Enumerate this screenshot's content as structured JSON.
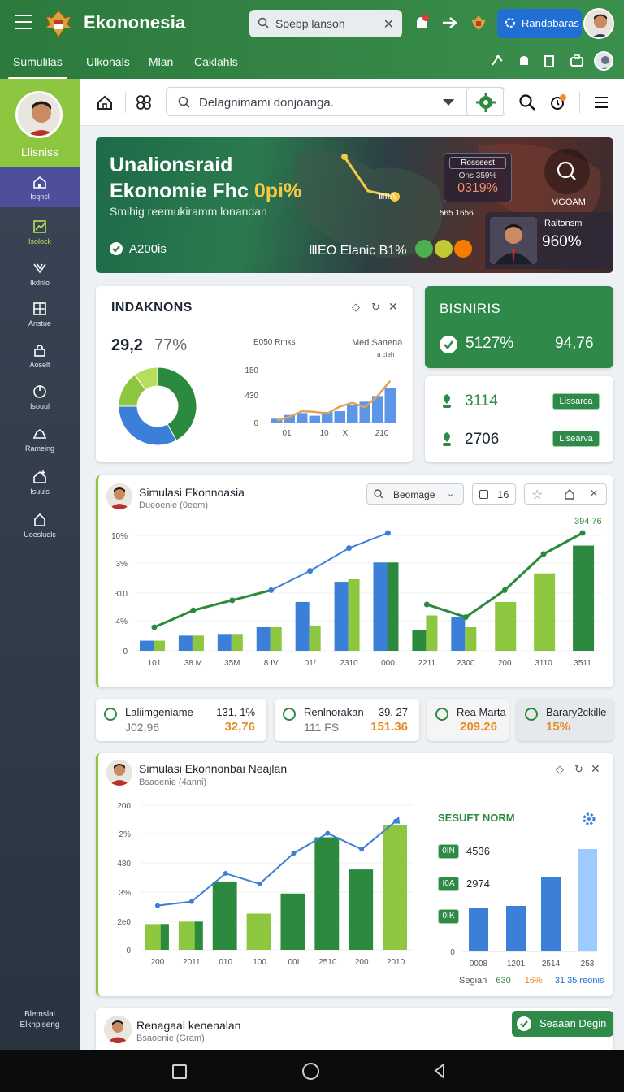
{
  "app": {
    "title": "Ekononesia",
    "search_text": "Soebp lansoh",
    "user_button": "Randabaras"
  },
  "nav_tabs": [
    "Sumulilas",
    "Ulkonals",
    "Mlan",
    "Caklahls"
  ],
  "sidebar": {
    "top_label": "Llisniss",
    "items": [
      {
        "label": "Isqncl",
        "icon": "home-icon"
      },
      {
        "label": "Isolock",
        "icon": "chart-icon"
      },
      {
        "label": "Ikdnlo",
        "icon": "branch-icon"
      },
      {
        "label": "Anstue",
        "icon": "grid-icon"
      },
      {
        "label": "Aoselt",
        "icon": "lock-icon"
      },
      {
        "label": "Isouul",
        "icon": "circle-icon"
      },
      {
        "label": "Rameing",
        "icon": "cloud-icon"
      },
      {
        "label": "Isuuls",
        "icon": "house-plus-icon"
      },
      {
        "label": "Uoesluelc",
        "icon": "home-outline-icon"
      }
    ],
    "footer": [
      "Blemslai",
      "Elknpiseng"
    ]
  },
  "toolbar": {
    "search_text": "Delagnimami donjoanga."
  },
  "hero": {
    "title_line1": "Unalionsraid",
    "title_line2": "Ekonomie Fhc",
    "title_highlight": "0pi%",
    "subtitle": "Smihig reemukiramm lonandan",
    "footer_label": "A200is",
    "mid_label": "ⅢEO Elanic B1%",
    "box_top": "Rosseest",
    "box_mid": "Ons 359%",
    "box_value": "0319%",
    "box_chart_label": "ⅢIIA",
    "rate_label": "565 1656",
    "right_label": "MGOAM",
    "card_name": "Raitonsm",
    "card_value": "960%"
  },
  "card_indak": {
    "title": "INDAKNONS",
    "big_value": "29,2",
    "big_pct": "77%",
    "mini_title_left": "E050 Rmks",
    "mini_title_right": "Med Sanena",
    "mini_sub": "a cieh",
    "y_ticks": [
      "150",
      "430",
      "0"
    ],
    "x_ticks": [
      "01",
      "10",
      "X",
      "210"
    ]
  },
  "card_bisniris": {
    "title": "BISNIRIS",
    "left_value": "5127%",
    "right_value": "94,76"
  },
  "card_small": {
    "rows": [
      {
        "value": "3114",
        "tag": "Lissarca"
      },
      {
        "value": "2706",
        "tag": "Lisearva"
      }
    ]
  },
  "sim1": {
    "title": "Simulasi Ekonnoasia",
    "subtitle": "Dueoenie (0eem)",
    "dropdown": "Beomage",
    "toolbar_num": "16",
    "corner_value": "394 76",
    "y_ticks": [
      "10%",
      "3%",
      "310",
      "4%",
      "0"
    ],
    "x_ticks": [
      "101",
      "38.M",
      "35M",
      "8 IV",
      "01/",
      "2310",
      "000",
      "2211",
      "2300",
      "200",
      "3110",
      "3511"
    ]
  },
  "stats": [
    {
      "name": "Laliimgeniame",
      "sub": "J02.96",
      "pct": "131, 1%",
      "value": "32,76"
    },
    {
      "name": "Renlnorakan",
      "sub": "111 FS",
      "pct": "39, 27",
      "value": "151.36"
    },
    {
      "name": "Rea Marta",
      "sub": "",
      "pct": "",
      "value": "209.26"
    },
    {
      "name": "Barary2ckille",
      "sub": "",
      "pct": "",
      "value": "15%"
    }
  ],
  "sim2": {
    "title": "Simulasi Ekonnonbai Neajlan",
    "subtitle": "Bsaoenie (4anni)",
    "y_ticks": [
      "200",
      "2%",
      "480",
      "3%",
      "2e0",
      "0"
    ],
    "x_ticks": [
      "200",
      "2011",
      "010",
      "100",
      "00I",
      "2510",
      "200",
      "2010"
    ],
    "side_title": "SESUFT NORM",
    "side_rows": [
      {
        "tag": "0IN",
        "value": "4536"
      },
      {
        "tag": "I0A",
        "value": "2974"
      },
      {
        "tag": "0IK",
        "value": ""
      }
    ],
    "side_x_ticks": [
      "0",
      "0008",
      "1201",
      "2514",
      "253"
    ],
    "side_footer": [
      {
        "text": "Segian",
        "color": "#555555"
      },
      {
        "text": "630",
        "color": "#2b8a3e"
      },
      {
        "text": "16%",
        "color": "#e78b2a"
      },
      {
        "text": "31 35 reonis",
        "color": "#1f6fd4"
      }
    ]
  },
  "bottom_card": {
    "title": "Renagaal kenenalan",
    "subtitle": "Bsaoenie (Gram)",
    "button": "Seaaan Degin"
  },
  "colors": {
    "green": "#2b8a3e",
    "lime": "#8dc63f",
    "blue": "#3c7fd8",
    "orange": "#e78b2a",
    "sidebar": "#2f3946"
  },
  "chart_data": [
    {
      "type": "pie",
      "title": "INDAKNONS",
      "slices": [
        {
          "color": "#2b8a3e",
          "value": 42
        },
        {
          "color": "#3c7fd8",
          "value": 33
        },
        {
          "color": "#8dc63f",
          "value": 15
        },
        {
          "color": "#b7dd5d",
          "value": 10
        }
      ]
    },
    {
      "type": "bar",
      "title": "E050 Rmks",
      "categories": [
        "01",
        "",
        "",
        "10",
        "",
        "",
        "X",
        "",
        "",
        "210"
      ],
      "series": [
        {
          "values": [
            10,
            20,
            25,
            18,
            28,
            30,
            45,
            55,
            70,
            90
          ]
        }
      ],
      "line": [
        5,
        15,
        30,
        28,
        24,
        42,
        52,
        40,
        70,
        110
      ],
      "ylim": [
        0,
        150
      ]
    },
    {
      "type": "bar",
      "title": "Simulasi Ekonnoasia",
      "categories": [
        "101",
        "38.M",
        "35M",
        "8 IV",
        "01/",
        "2310",
        "000",
        "2211",
        "2300",
        "200",
        "3110",
        "3511"
      ],
      "series": [
        {
          "values": [
            12,
            18,
            20,
            28,
            58,
            82,
            105,
            25,
            40,
            0,
            0,
            0
          ]
        },
        {
          "values": [
            12,
            18,
            20,
            28,
            30,
            85,
            105,
            42,
            28,
            58,
            92,
            125
          ]
        }
      ],
      "line": [
        28,
        48,
        60,
        72,
        95,
        122,
        140,
        55,
        40,
        72,
        115,
        140
      ],
      "ylim": [
        0,
        140
      ]
    },
    {
      "type": "bar",
      "title": "Simulasi Ekonnonbai Neajlan",
      "categories": [
        "200",
        "2011",
        "010",
        "100",
        "00I",
        "2510",
        "200",
        "2010"
      ],
      "series": [
        {
          "values": [
            32,
            35,
            85,
            45,
            70,
            140,
            100,
            155
          ]
        }
      ],
      "line": [
        55,
        60,
        95,
        82,
        120,
        145,
        125,
        160
      ],
      "ylim": [
        0,
        180
      ]
    },
    {
      "type": "bar",
      "title": "SESUFT NORM",
      "categories": [
        "0008",
        "1201",
        "2514",
        "253"
      ],
      "series": [
        {
          "values": [
            38,
            40,
            65,
            90
          ]
        }
      ],
      "ylim": [
        0,
        100
      ]
    }
  ]
}
